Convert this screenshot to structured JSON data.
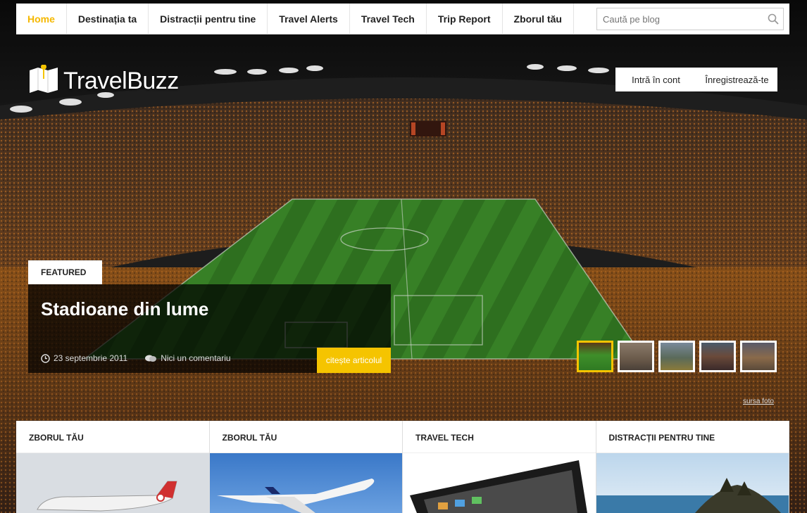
{
  "nav": {
    "items": [
      {
        "label": "Home",
        "active": true
      },
      {
        "label": "Destinația ta",
        "active": false
      },
      {
        "label": "Distracții pentru tine",
        "active": false
      },
      {
        "label": "Travel Alerts",
        "active": false
      },
      {
        "label": "Travel Tech",
        "active": false
      },
      {
        "label": "Trip Report",
        "active": false
      },
      {
        "label": "Zborul tău",
        "active": false
      }
    ],
    "search_placeholder": "Caută pe blog"
  },
  "brand": {
    "name": "TravelBuzz"
  },
  "account": {
    "login": "Intră în cont",
    "register": "Înregistrează-te"
  },
  "featured": {
    "tag": "FEATURED",
    "title": "Stadioane din lume",
    "date": "23 septembrie 2011",
    "comments": "Nici un comentariu",
    "read_more": "citește articolul"
  },
  "slider": {
    "thumbnail_count": 5,
    "active_index": 0,
    "credit": "sursa foto"
  },
  "cards": [
    {
      "title": "ZBORUL TĂU"
    },
    {
      "title": "ZBORUL TĂU"
    },
    {
      "title": "TRAVEL TECH"
    },
    {
      "title": "DISTRACȚII PENTRU TINE"
    }
  ],
  "colors": {
    "accent": "#f5c400",
    "pitch": "#3f8f2a",
    "crowd": "#b85a1a"
  }
}
